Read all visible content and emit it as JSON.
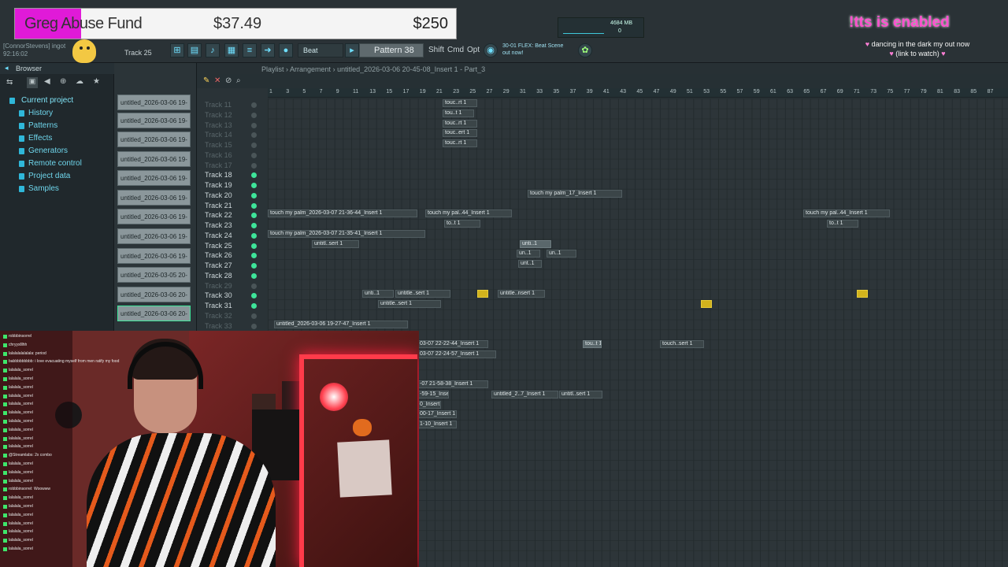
{
  "fundraiser": {
    "name": "Greg Abuse Fund",
    "raised": "$37.49",
    "goal": "$250",
    "progress": 0.15
  },
  "overlay": {
    "user_info_1": "[ConnorStevens] ingot",
    "user_info_2": "92:16:02",
    "alert_title": "!tts is enabled",
    "alert_msg_1": "dancing in the dark my out now",
    "alert_msg_2": "(link to watch)"
  },
  "toolbar": {
    "track_selector": "Track 25",
    "beat_label": "Beat",
    "pattern_label": "Pattern 38",
    "shift_label": "Shift",
    "cmd_label": "Cmd",
    "opt_label": "Opt",
    "hint_1": "30-01 FLEX: Beat Scene",
    "hint_2": "out now!",
    "perf_memory": "4684 MB",
    "perf_polyphony": "0",
    "perf_cpu": "0"
  },
  "browser": {
    "title": "Browser",
    "items": [
      "Current project",
      "History",
      "Patterns",
      "Effects",
      "Generators",
      "Remote control",
      "Project data",
      "Samples"
    ]
  },
  "picker": {
    "clips": [
      "untitled_2026-03-06 19-",
      "untitled_2026-03-06 19-",
      "untitled_2026-03-06 19-",
      "untitled_2026-03-06 19-",
      "untitled_2026-03-06 19-",
      "untitled_2026-03-06 19-",
      "untitled_2026-03-06 19-",
      "untitled_2026-03-06 19-",
      "untitled_2026-03-06 19-",
      "untitled_2026-03-05 20-",
      "untitled_2026-03-06 20-",
      "untitled_2026-03-06 20-"
    ]
  },
  "playlist": {
    "title_prefix": "Playlist",
    "title_mode": "Arrangement",
    "title_name": "untitled_2026-03-06 20-45-08_Insert 1 - Part_3",
    "ruler": [
      "1",
      "3",
      "5",
      "7",
      "9",
      "11",
      "13",
      "15",
      "17",
      "19",
      "21",
      "23",
      "25",
      "27",
      "29",
      "31",
      "33",
      "35",
      "37",
      "39",
      "41",
      "43",
      "45",
      "47",
      "49",
      "51",
      "53",
      "55",
      "57",
      "59",
      "61",
      "63",
      "65",
      "67",
      "69",
      "71",
      "73",
      "75",
      "77",
      "79",
      "81",
      "83",
      "85",
      "87"
    ],
    "tracks": [
      {
        "name": "Track 11",
        "on": false
      },
      {
        "name": "Track 12",
        "on": false
      },
      {
        "name": "Track 13",
        "on": false
      },
      {
        "name": "Track 14",
        "on": false
      },
      {
        "name": "Track 15",
        "on": false
      },
      {
        "name": "Track 16",
        "on": false
      },
      {
        "name": "Track 17",
        "on": false
      },
      {
        "name": "Track 18",
        "on": true
      },
      {
        "name": "Track 19",
        "on": true
      },
      {
        "name": "Track 20",
        "on": true
      },
      {
        "name": "Track 21",
        "on": true
      },
      {
        "name": "Track 22",
        "on": true
      },
      {
        "name": "Track 23",
        "on": true
      },
      {
        "name": "Track 24",
        "on": true
      },
      {
        "name": "Track 25",
        "on": true
      },
      {
        "name": "Track 26",
        "on": true
      },
      {
        "name": "Track 27",
        "on": true
      },
      {
        "name": "Track 28",
        "on": true
      },
      {
        "name": "Track 29",
        "on": false
      },
      {
        "name": "Track 30",
        "on": true
      },
      {
        "name": "Track 31",
        "on": true
      },
      {
        "name": "Track 32",
        "on": false
      },
      {
        "name": "Track 33",
        "on": false
      }
    ],
    "clips": [
      {
        "label": "touc..rt 1",
        "style": "dark"
      },
      {
        "label": "tou..t 1",
        "style": "dark"
      },
      {
        "label": "touc..rt 1",
        "style": "dark"
      },
      {
        "label": "touc..ert 1",
        "style": "dark"
      },
      {
        "label": "touc..rt 1",
        "style": "dark"
      },
      {
        "label": "touch my palm_17_Insert 1",
        "style": "dark"
      },
      {
        "label": "touch my palm_2026-03-07 21-36-44_Insert 1",
        "style": "dark"
      },
      {
        "label": "touch my pal..44_Insert 1",
        "style": "dark"
      },
      {
        "label": "touch my pal..44_Insert 1",
        "style": "dark"
      },
      {
        "label": "to..t 1",
        "style": "dark"
      },
      {
        "label": "to..t 1",
        "style": "dark"
      },
      {
        "label": "touch my palm_2026-03-07 21-35-41_Insert 1",
        "style": "dark"
      },
      {
        "label": "untitl..sert 1",
        "style": "dark"
      },
      {
        "label": "unti..1",
        "style": "normal"
      },
      {
        "label": "unt..1",
        "style": "dark"
      },
      {
        "label": "un..1",
        "style": "dark"
      },
      {
        "label": "un..1",
        "style": "dark"
      },
      {
        "label": "unti..1",
        "style": "dark"
      },
      {
        "label": "untitle..sert 1",
        "style": "dark"
      },
      {
        "label": "untitle..nsert 1",
        "style": "dark"
      },
      {
        "label": "untitle..sert 1",
        "style": "dark"
      },
      {
        "label": "untitled_2026-03-06 19-27-47_Insert 1",
        "style": "dark"
      },
      {
        "label": "03-07 22-22-44_Insert 1",
        "style": "dark"
      },
      {
        "label": "tou..t 1",
        "style": "normal"
      },
      {
        "label": "touch..sert 1",
        "style": "dark"
      },
      {
        "label": "03-07 22-24-57_Insert 1",
        "style": "dark"
      },
      {
        "label": "-07 21-58-38_Insert 1",
        "style": "dark"
      },
      {
        "label": "-59-15_Insert 1",
        "style": "dark"
      },
      {
        "label": "untitled_2..7_Insert 1",
        "style": "dark"
      },
      {
        "label": "untitl..sert 1",
        "style": "dark"
      },
      {
        "label": "0_Insert 1",
        "style": "dark"
      },
      {
        "label": "00-17_Insert 1",
        "style": "dark"
      },
      {
        "label": "1-10_Insert 1",
        "style": "dark"
      },
      {
        "label": "",
        "style": "yellow"
      },
      {
        "label": "",
        "style": "yellow"
      },
      {
        "label": "",
        "style": "yellow"
      }
    ]
  },
  "chat": {
    "lines": [
      "robbbinsorrel",
      "chryyxlllhh",
      "lalalalalalalala: period",
      "babbbbbbbbb: i love evacuating myself from men ratify my food",
      "lalalala_sorrel",
      "lalalala_sorrel",
      "lalalala_sorrel",
      "lalalala_sorrel",
      "lalalala_sorrel",
      "lalalala_sorrel",
      "lalalala_sorrel",
      "lalalala_sorrel",
      "lalalala_sorrel",
      "lalalala_sorrel",
      "@Streamlabs: 2x combo",
      "lalalala_sorrel",
      "lalalala_sorrel",
      "lalalala_sorrel",
      "robbbinsorrel: Woowww",
      "lalalala_sorrel",
      "lalalala_sorrel",
      "lalalala_sorrel",
      "lalalala_sorrel",
      "lalalala_sorrel",
      "lalalala_sorrel",
      "lalalala_sorrel"
    ]
  },
  "colors": {
    "fund_fill": "#e01ad8",
    "alert": "#ff4fcf",
    "led_on": "#3ee59a",
    "accent": "#6fe0ff"
  }
}
